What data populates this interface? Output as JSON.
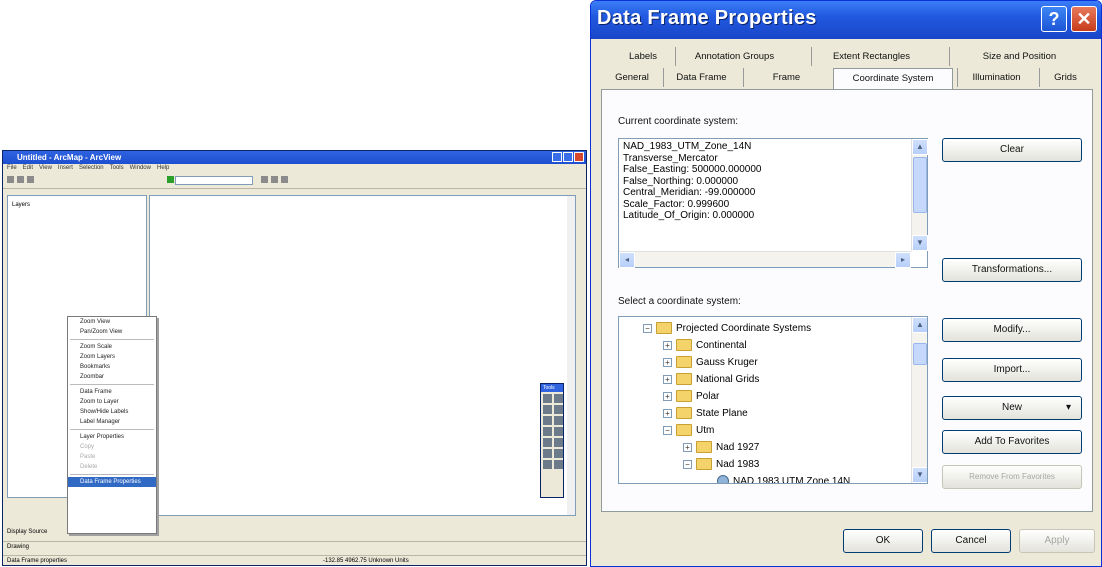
{
  "arcview": {
    "title": "Untitled - ArcMap - ArcView",
    "menu": [
      "File",
      "Edit",
      "View",
      "Insert",
      "Selection",
      "Tools",
      "Window",
      "Help"
    ],
    "layers_label": "Layers",
    "context_menu": [
      "Zoom View",
      "Pan/Zoom View",
      "Zoom Scale",
      "Zoom Layers",
      "Bookmarks",
      "Zoombar",
      "Data Frame",
      "Zoom to Layer",
      "Show/Hide Labels",
      "Label Manager",
      "Layer Properties",
      "Copy",
      "Paste",
      "Delete",
      "Data Frame Properties"
    ],
    "tabs": [
      "Display",
      "Source"
    ],
    "drawing_label": "Drawing",
    "status_left": "Data Frame properties",
    "status_coords": "-132.85  4962.75 Unknown Units"
  },
  "dialog": {
    "title": "Data Frame Properties",
    "help_glyph": "?",
    "close_glyph": "✕",
    "tabs_row1": [
      "Labels",
      "Annotation Groups",
      "Extent Rectangles",
      "Size and Position"
    ],
    "tabs_row2": [
      "General",
      "Data Frame",
      "Frame",
      "Coordinate System",
      "Illumination",
      "Grids"
    ],
    "current_label": "Current coordinate system:",
    "current_text": "NAD_1983_UTM_Zone_14N\nTransverse_Mercator\nFalse_Easting: 500000.000000\nFalse_Northing: 0.000000\nCentral_Meridian: -99.000000\nScale_Factor: 0.999600\nLatitude_Of_Origin: 0.000000",
    "clear_button": "Clear",
    "transformations_button": "Transformations...",
    "select_label": "Select a coordinate system:",
    "tree": [
      {
        "label": "Projected Coordinate Systems",
        "level": 0,
        "expander": "−",
        "icon": "folder"
      },
      {
        "label": "Continental",
        "level": 1,
        "expander": "+",
        "icon": "folder"
      },
      {
        "label": "Gauss Kruger",
        "level": 1,
        "expander": "+",
        "icon": "folder"
      },
      {
        "label": "National Grids",
        "level": 1,
        "expander": "+",
        "icon": "folder"
      },
      {
        "label": "Polar",
        "level": 1,
        "expander": "+",
        "icon": "folder"
      },
      {
        "label": "State Plane",
        "level": 1,
        "expander": "+",
        "icon": "folder"
      },
      {
        "label": "Utm",
        "level": 1,
        "expander": "−",
        "icon": "folder"
      },
      {
        "label": "Nad 1927",
        "level": 2,
        "expander": "+",
        "icon": "folder"
      },
      {
        "label": "Nad 1983",
        "level": 2,
        "expander": "−",
        "icon": "folder"
      },
      {
        "label": "NAD 1983 UTM Zone 14N",
        "level": 3,
        "expander": "",
        "icon": "globe"
      }
    ],
    "modify_button": "Modify...",
    "import_button": "Import...",
    "new_button": "New",
    "new_arrow": "▾",
    "add_fav_button": "Add To Favorites",
    "remove_fav_button": "Remove From Favorites",
    "ok_button": "OK",
    "cancel_button": "Cancel",
    "apply_button": "Apply"
  }
}
